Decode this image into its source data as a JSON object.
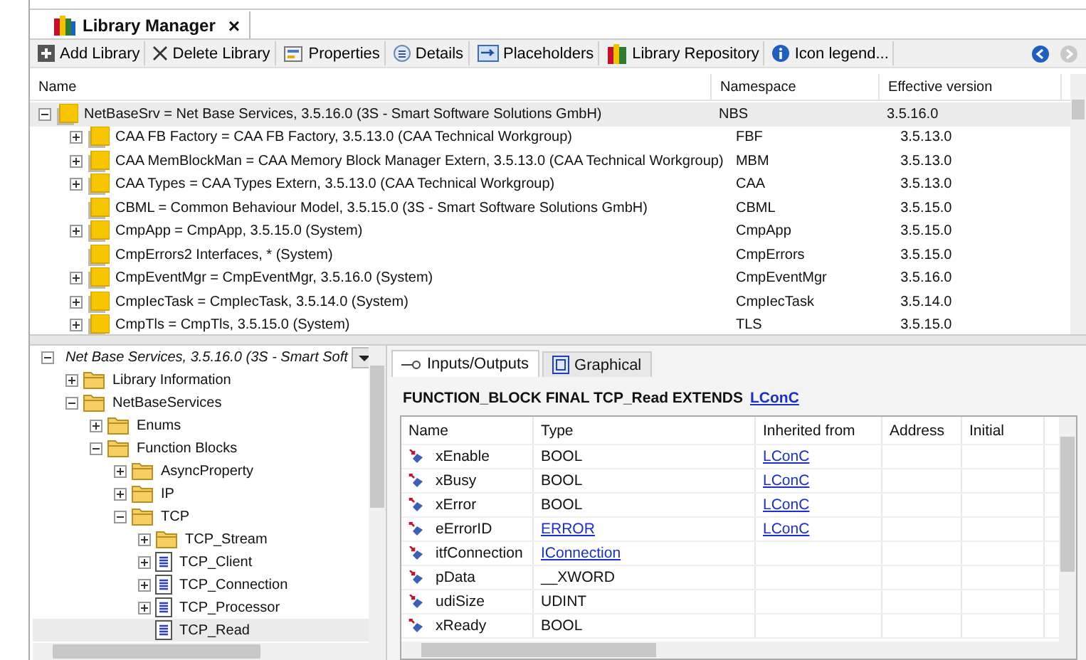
{
  "editor_tab": {
    "title": "Library Manager",
    "close": "×"
  },
  "toolbar": [
    {
      "kind": "add",
      "label": "Add Library"
    },
    {
      "kind": "delete",
      "label": "Delete Library"
    },
    {
      "kind": "properties",
      "label": "Properties"
    },
    {
      "kind": "details",
      "label": "Details"
    },
    {
      "kind": "placeholders",
      "label": "Placeholders"
    },
    {
      "kind": "repository",
      "label": "Library Repository"
    },
    {
      "kind": "legend",
      "label": "Icon legend..."
    }
  ],
  "libraries": {
    "columns": [
      "Name",
      "Namespace",
      "Effective version"
    ],
    "rows": [
      {
        "name": "NetBaseSrv = Net Base Services, 3.5.16.0 (3S - Smart Software Solutions GmbH)",
        "namespace": "NBS",
        "version": "3.5.16.0",
        "expanded": true,
        "selected": true,
        "children": [
          {
            "name": "CAA FB Factory = CAA FB Factory, 3.5.13.0 (CAA Technical Workgroup)",
            "namespace": "FBF",
            "version": "3.5.13.0",
            "expanded": false,
            "selected": false
          },
          {
            "name": "CAA MemBlockMan = CAA Memory Block Manager Extern, 3.5.13.0 (CAA Technical Workgroup)",
            "namespace": "MBM",
            "version": "3.5.13.0",
            "expanded": false,
            "selected": false
          },
          {
            "name": "CAA Types = CAA Types Extern, 3.5.13.0 (CAA Technical Workgroup)",
            "namespace": "CAA",
            "version": "3.5.13.0",
            "expanded": false,
            "selected": false
          },
          {
            "name": "CBML = Common Behaviour Model, 3.5.15.0 (3S - Smart Software Solutions GmbH)",
            "namespace": "CBML",
            "version": "3.5.15.0",
            "selected": false
          },
          {
            "name": "CmpApp = CmpApp, 3.5.15.0 (System)",
            "namespace": "CmpApp",
            "version": "3.5.15.0",
            "expanded": false,
            "selected": false
          },
          {
            "name": "CmpErrors2 Interfaces, * (System)",
            "namespace": "CmpErrors",
            "version": "3.5.15.0",
            "selected": false
          },
          {
            "name": "CmpEventMgr = CmpEventMgr, 3.5.16.0 (System)",
            "namespace": "CmpEventMgr",
            "version": "3.5.16.0",
            "expanded": false,
            "selected": false
          },
          {
            "name": "CmpIecTask = CmpIecTask, 3.5.14.0 (System)",
            "namespace": "CmpIecTask",
            "version": "3.5.14.0",
            "expanded": false,
            "selected": false
          },
          {
            "name": "CmpTls = CmpTls, 3.5.15.0 (System)",
            "namespace": "TLS",
            "version": "3.5.15.0",
            "expanded": false,
            "selected": false
          }
        ]
      }
    ]
  },
  "tree": [
    {
      "label": "Net Base Services, 3.5.16.0 (3S - Smart Soft",
      "kind": "library",
      "expanded": true,
      "selected": false,
      "children": [
        {
          "label": "Library Information",
          "kind": "folder",
          "expanded": false,
          "selected": false
        },
        {
          "label": "NetBaseServices",
          "kind": "folder",
          "expanded": true,
          "selected": false,
          "children": [
            {
              "label": "Enums",
              "kind": "folder",
              "expanded": false,
              "selected": false
            },
            {
              "label": "Function Blocks",
              "kind": "folder",
              "expanded": true,
              "selected": false,
              "children": [
                {
                  "label": "AsyncProperty",
                  "kind": "folder",
                  "expanded": false,
                  "selected": false
                },
                {
                  "label": "IP",
                  "kind": "folder",
                  "expanded": false,
                  "selected": false
                },
                {
                  "label": "TCP",
                  "kind": "folder",
                  "expanded": true,
                  "selected": false,
                  "children": [
                    {
                      "label": "TCP_Stream",
                      "kind": "folder",
                      "expanded": false,
                      "selected": false
                    },
                    {
                      "label": "TCP_Client",
                      "kind": "pou",
                      "expanded": false,
                      "selected": false
                    },
                    {
                      "label": "TCP_Connection",
                      "kind": "pou",
                      "expanded": false,
                      "selected": false
                    },
                    {
                      "label": "TCP_Processor",
                      "kind": "pou",
                      "expanded": false,
                      "selected": false
                    },
                    {
                      "label": "TCP_Read",
                      "kind": "pou",
                      "selected": true
                    }
                  ]
                }
              ]
            }
          ]
        }
      ]
    }
  ],
  "detail_tabs": [
    {
      "label": "Inputs/Outputs",
      "kind": "io",
      "selected": true
    },
    {
      "label": "Graphical",
      "kind": "graphical",
      "selected": false
    }
  ],
  "declaration": {
    "text": "FUNCTION_BLOCK FINAL TCP_Read EXTENDS",
    "link": "LConC"
  },
  "io_table": {
    "columns": [
      "Name",
      "Type",
      "Inherited from",
      "Address",
      "Initial"
    ],
    "rows": [
      {
        "kind": "input",
        "name": "xEnable",
        "type": "BOOL",
        "type_link": false,
        "inherited": "LConC"
      },
      {
        "kind": "output",
        "name": "xBusy",
        "type": "BOOL",
        "type_link": false,
        "inherited": "LConC"
      },
      {
        "kind": "output",
        "name": "xError",
        "type": "BOOL",
        "type_link": false,
        "inherited": "LConC"
      },
      {
        "kind": "output",
        "name": "eErrorID",
        "type": "ERROR",
        "type_link": true,
        "inherited": "LConC"
      },
      {
        "kind": "input",
        "name": "itfConnection",
        "type": "IConnection",
        "type_link": true
      },
      {
        "kind": "input",
        "name": "pData",
        "type": "__XWORD",
        "type_link": false
      },
      {
        "kind": "input",
        "name": "udiSize",
        "type": "UDINT",
        "type_link": false
      },
      {
        "kind": "output",
        "name": "xReady",
        "type": "BOOL",
        "type_link": false
      }
    ]
  }
}
